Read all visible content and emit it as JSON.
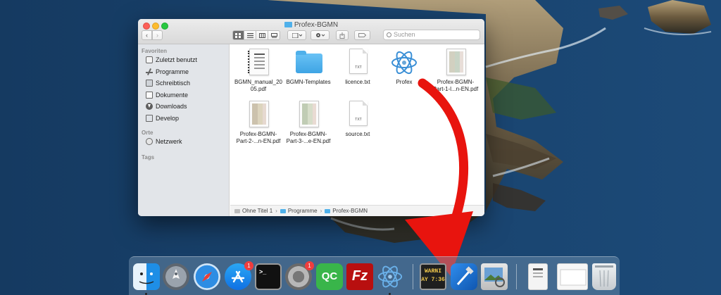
{
  "window": {
    "title": "Profex-BGMN",
    "search_placeholder": "Suchen"
  },
  "sidebar": {
    "favorites_heading": "Favoriten",
    "favorites": [
      {
        "label": "Zuletzt benutzt",
        "icon": "clock-icon"
      },
      {
        "label": "Programme",
        "icon": "applications-icon"
      },
      {
        "label": "Schreibtisch",
        "icon": "desktop-icon"
      },
      {
        "label": "Dokumente",
        "icon": "documents-icon"
      },
      {
        "label": "Downloads",
        "icon": "downloads-icon"
      },
      {
        "label": "Develop",
        "icon": "folder-icon"
      }
    ],
    "places_heading": "Orte",
    "places": [
      {
        "label": "Netzwerk",
        "icon": "network-icon"
      }
    ],
    "tags_heading": "Tags"
  },
  "files": [
    {
      "name": "BGMN_manual_2005.pdf",
      "line1": "BGMN_manual_20",
      "line2": "05.pdf",
      "kind": "pdf"
    },
    {
      "name": "BGMN-Templates",
      "line1": "BGMN-Templates",
      "line2": "",
      "kind": "folder"
    },
    {
      "name": "licence.txt",
      "line1": "licence.txt",
      "line2": "",
      "kind": "txt"
    },
    {
      "name": "Profex",
      "line1": "Profex",
      "line2": "",
      "kind": "app"
    },
    {
      "name": "Profex-BGMN-Part-1-l...n-EN.pdf",
      "line1": "Profex-BGMN-",
      "line2": "Part-1-l...n-EN.pdf",
      "kind": "pdf"
    },
    {
      "name": "Profex-BGMN-Part-2-...n-EN.pdf",
      "line1": "Profex-BGMN-",
      "line2": "Part-2-...n-EN.pdf",
      "kind": "pdf"
    },
    {
      "name": "Profex-BGMN-Part-3-...e-EN.pdf",
      "line1": "Profex-BGMN-",
      "line2": "Part-3-...e-EN.pdf",
      "kind": "pdf"
    },
    {
      "name": "source.txt",
      "line1": "source.txt",
      "line2": "",
      "kind": "txt"
    }
  ],
  "txt_badge": "TXT",
  "pathbar": {
    "items": [
      "Ohne Titel 1",
      "Programme",
      "Profex-BGMN"
    ],
    "separator": "›"
  },
  "dock": {
    "apps": [
      {
        "name": "Finder",
        "icon": "finder-icon",
        "running": true
      },
      {
        "name": "Launchpad",
        "icon": "launchpad-icon"
      },
      {
        "name": "Safari",
        "icon": "safari-icon"
      },
      {
        "name": "App Store",
        "icon": "app-store-icon",
        "badge": "1"
      },
      {
        "name": "Terminal",
        "icon": "terminal-icon",
        "glyph": ">_"
      },
      {
        "name": "Systemeinstellungen",
        "icon": "system-preferences-icon",
        "badge": "1"
      },
      {
        "name": "QC",
        "icon": "qc-icon",
        "glyph": "QC"
      },
      {
        "name": "FileZilla",
        "icon": "filezilla-icon",
        "glyph": "Fz"
      },
      {
        "name": "Profex",
        "icon": "profex-icon",
        "running": true
      },
      {
        "name": "Konsole",
        "icon": "console-icon",
        "glyph": "WARNI\nAY 7:36"
      },
      {
        "name": "Xcode",
        "icon": "xcode-icon"
      },
      {
        "name": "Vorschau",
        "icon": "preview-icon"
      },
      {
        "name": "Dokument",
        "icon": "document-icon"
      },
      {
        "name": "Stapel",
        "icon": "stack-icon"
      },
      {
        "name": "Papierkorb",
        "icon": "trash-icon"
      }
    ],
    "badge_app_store": "1",
    "badge_sysprefs": "1",
    "terminal_glyph": ">_",
    "qc_glyph": "QC",
    "filezilla_glyph": "Fz",
    "console_line1": "WARNI",
    "console_line2": "AY 7:36"
  },
  "colors": {
    "arrow": "#e8140e",
    "folder": "#4fb0ea",
    "sidebar": "#e2e5e9"
  }
}
